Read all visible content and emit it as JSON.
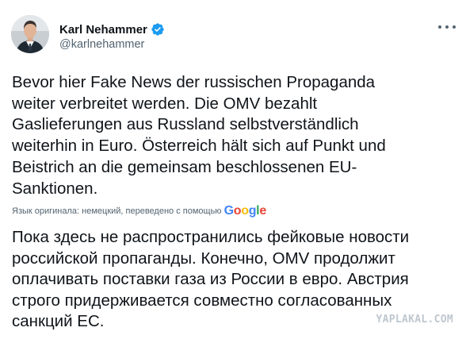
{
  "author": {
    "display_name": "Karl Nehammer",
    "handle": "@karlnehammer",
    "verified": true,
    "avatar_icon": "profile-photo"
  },
  "menu": {
    "icon": "more-horizontal-icon"
  },
  "tweet": {
    "lines": [
      "Bevor hier Fake News der russischen Propaganda",
      "weiter verbreitet werden. Die OMV bezahlt",
      "Gaslieferungen aus Russland selbstverständlich",
      "weiterhin in Euro. Österreich hält sich auf Punkt und",
      "Beistrich an die gemeinsam beschlossenen EU-",
      "Sanktionen."
    ]
  },
  "translation": {
    "meta_text": "Язык оригинала: немецкий, переведено с помощью",
    "provider": "Google",
    "lines": [
      "Пока здесь не распространились фейковые новости",
      "российской пропаганды. Конечно, OMV продолжит",
      "оплачивать поставки газа из России в евро. Австрия",
      "строго придерживается совместно согласованных",
      "санкций ЕС."
    ]
  },
  "watermark": {
    "text": "YAPLAKAL.COM"
  },
  "colors": {
    "verified_blue": "#1d9bf0",
    "text_primary": "#0f1419",
    "text_secondary": "#536471",
    "meta_link": "#536471"
  }
}
